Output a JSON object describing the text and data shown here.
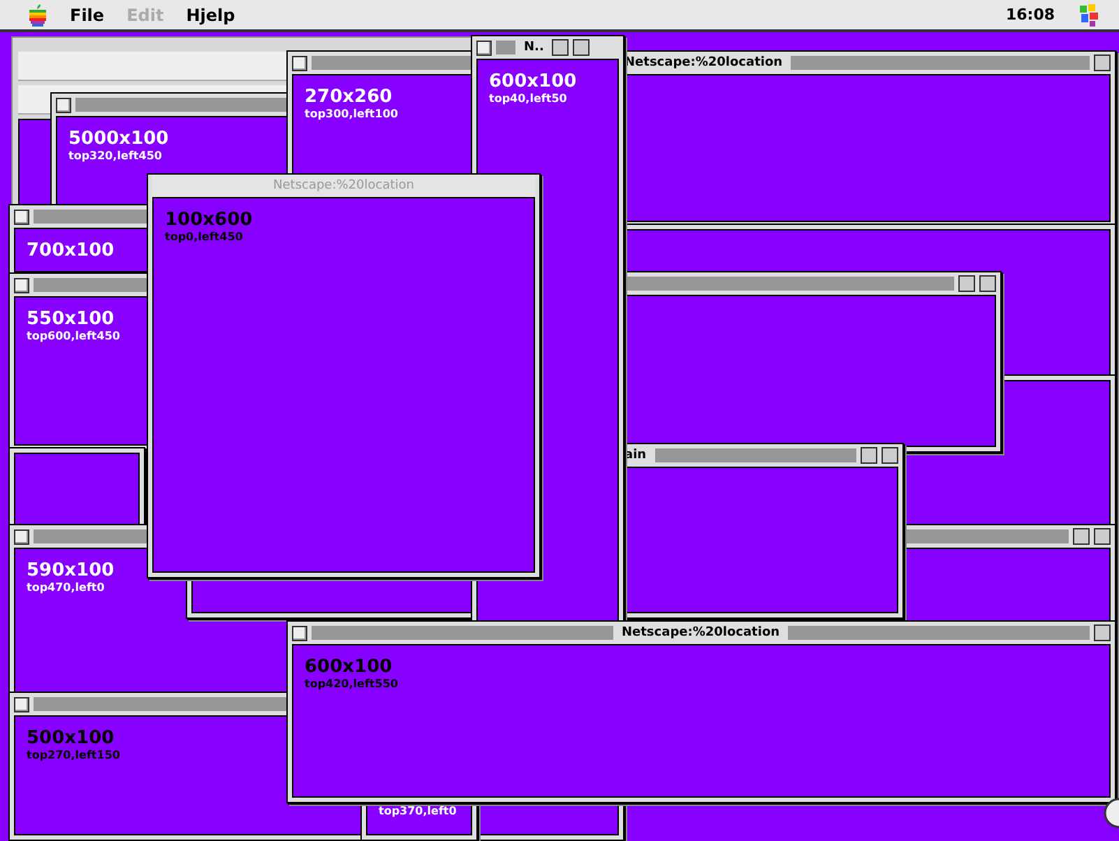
{
  "menu_bar": {
    "menus": [
      {
        "label": "File",
        "disabled": false
      },
      {
        "label": "Edit",
        "disabled": true
      },
      {
        "label": "Hjelp",
        "disabled": false
      }
    ],
    "clock": "16:08"
  },
  "windows": [
    {
      "kind": "browser"
    },
    {
      "kind": "window",
      "active": true,
      "title": "Netscape:%20location"
    },
    {
      "kind": "window"
    },
    {
      "kind": "window"
    },
    {
      "kind": "window",
      "active": true
    },
    {
      "kind": "window",
      "active": true
    },
    {
      "kind": "window",
      "active": true,
      "title": "ain"
    },
    {
      "kind": "window",
      "active": true,
      "size_label": "5000x100",
      "position_label": "top320,left450",
      "color": "#ffffff"
    },
    {
      "kind": "window",
      "active": true,
      "size_label": "270x260",
      "position_label": "top300,left100",
      "color": "#ffffff"
    },
    {
      "kind": "window",
      "active": true,
      "size_label": "700x100",
      "color": "#ffffff"
    },
    {
      "kind": "window",
      "active": true,
      "size_label": "550x100",
      "position_label": "top600,left450",
      "color": "#ffffff"
    },
    {
      "kind": "window"
    },
    {
      "kind": "window",
      "active": true,
      "size_label": "590x100",
      "position_label": "top470,left0",
      "color": "#ffffff"
    },
    {
      "kind": "window"
    },
    {
      "kind": "window",
      "active": true,
      "title": "N..",
      "size_label": "600x100",
      "position_label": "top40,left50",
      "color": "#ffffff"
    },
    {
      "kind": "window",
      "active": false,
      "title": "Netscape:%20location",
      "size_label": "100x600",
      "position_label": "top0,left450",
      "color": "#000000"
    },
    {
      "kind": "window",
      "active": true,
      "size_label": "500x100",
      "position_label": "top270,left150",
      "color": "#000000"
    },
    {
      "kind": "window",
      "position_label": "top370,left0",
      "color": "#ffffff"
    },
    {
      "kind": "window",
      "active": true,
      "title": "Netscape:%20location",
      "size_label": "600x100",
      "position_label": "top420,left550",
      "color": "#000000"
    }
  ]
}
